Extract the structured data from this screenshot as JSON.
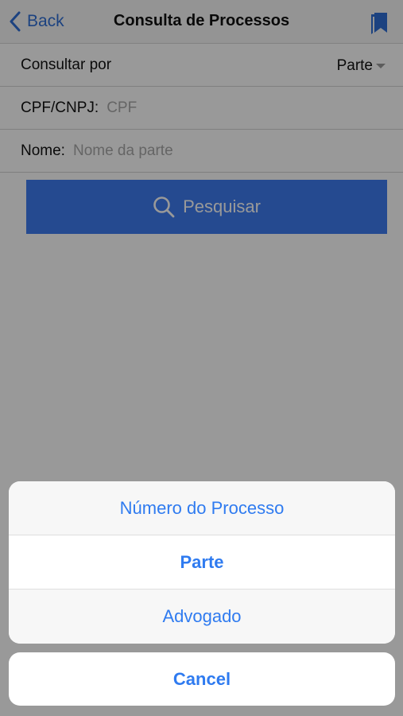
{
  "navbar": {
    "back_label": "Back",
    "title": "Consulta de Processos",
    "back_icon": "chevron-left-icon",
    "bookmark_icon": "bookmark-icon"
  },
  "form": {
    "consultar_label": "Consultar por",
    "consultar_value": "Parte",
    "cpf_label": "CPF/CNPJ:",
    "cpf_placeholder": "CPF",
    "nome_label": "Nome:",
    "nome_placeholder": "Nome da parte"
  },
  "search_button": {
    "label": "Pesquisar",
    "icon": "search-icon"
  },
  "action_sheet": {
    "options": [
      {
        "label": "Número do Processo"
      },
      {
        "label": "Parte"
      },
      {
        "label": "Advogado"
      }
    ],
    "cancel_label": "Cancel"
  },
  "colors": {
    "accent": "#2f7bf0",
    "button_bg": "#3e7cf0"
  }
}
